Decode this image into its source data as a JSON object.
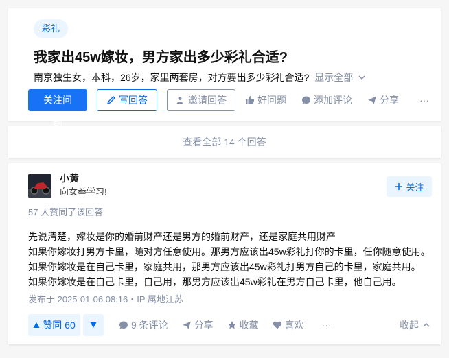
{
  "question": {
    "topic": "彩礼",
    "title": "我家出45w嫁妆，男方家出多少彩礼合适?",
    "detail": "南京独生女，本科，26岁，家里两套房，对方要出多少彩礼合适?",
    "show_all": "显示全部",
    "actions": {
      "follow": "关注问题",
      "write": "写回答",
      "invite": "邀请回答",
      "good": "好问题",
      "comment": "添加评论",
      "share": "分享",
      "more": "···"
    }
  },
  "view_all": "查看全部 14 个回答",
  "answer": {
    "author_name": "小黄",
    "author_bio": "向女拳学习!",
    "follow": "关注",
    "vote_summary": "57 人赞同了该回答",
    "paragraphs": [
      "先说清楚，嫁妆是你的婚前财产还是男方的婚前财产，还是家庭共用财产",
      "如果你嫁妆打男方卡里，随对方任意使用。那男方应该出45w彩礼打你的卡里，任你随意使用。",
      "如果你嫁妆是在自己卡里，家庭共用，那男方应该出45w彩礼打男方自己的卡里，家庭共用。",
      "如果你嫁妆是在自己卡里，自己用，那男方应该出45w彩礼在男方自己卡里，他自己用。"
    ],
    "published": "发布于 2025-01-06 08:16・IP 属地江苏",
    "actions": {
      "upvote": "赞同 60",
      "comments": "9 条评论",
      "share": "分享",
      "favorite": "收藏",
      "like": "喜欢",
      "more": "···",
      "collapse": "收起"
    }
  },
  "colors": {
    "brand": "#056de8",
    "brand_button": "#1772f6",
    "muted": "#8590a6",
    "tag_bg": "#ebf5ff"
  }
}
